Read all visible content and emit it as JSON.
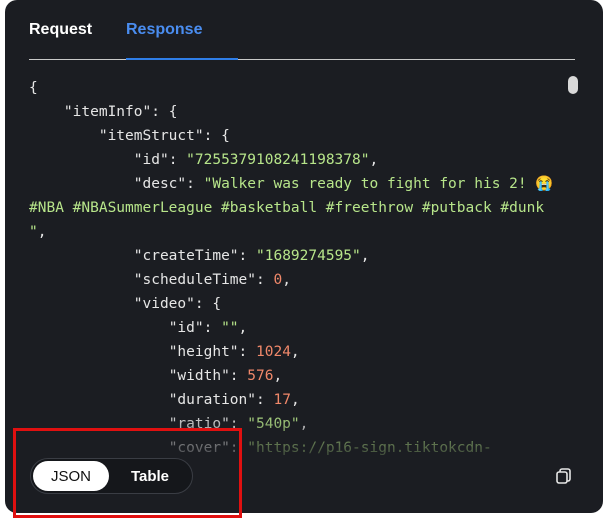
{
  "tabs": [
    {
      "label": "Request",
      "active": false
    },
    {
      "label": "Response",
      "active": true
    }
  ],
  "code_lines": [
    [
      {
        "t": "p",
        "v": "{"
      }
    ],
    [
      {
        "t": "p",
        "v": "    "
      },
      {
        "t": "k",
        "v": "\"itemInfo\""
      },
      {
        "t": "p",
        "v": ": {"
      }
    ],
    [
      {
        "t": "p",
        "v": "        "
      },
      {
        "t": "k",
        "v": "\"itemStruct\""
      },
      {
        "t": "p",
        "v": ": {"
      }
    ],
    [
      {
        "t": "p",
        "v": "            "
      },
      {
        "t": "k",
        "v": "\"id\""
      },
      {
        "t": "p",
        "v": ": "
      },
      {
        "t": "s",
        "v": "\"7255379108241198378\""
      },
      {
        "t": "p",
        "v": ","
      }
    ],
    [
      {
        "t": "p",
        "v": "            "
      },
      {
        "t": "k",
        "v": "\"desc\""
      },
      {
        "t": "p",
        "v": ": "
      },
      {
        "t": "s",
        "v": "\"Walker was ready to fight for his 2! "
      },
      {
        "t": "em",
        "v": "😭"
      }
    ],
    [
      {
        "t": "s",
        "v": "#NBA #NBASummerLeague #basketball #freethrow #putback #dunk"
      }
    ],
    [
      {
        "t": "s",
        "v": "\""
      },
      {
        "t": "p",
        "v": ","
      }
    ],
    [
      {
        "t": "p",
        "v": "            "
      },
      {
        "t": "k",
        "v": "\"createTime\""
      },
      {
        "t": "p",
        "v": ": "
      },
      {
        "t": "s",
        "v": "\"1689274595\""
      },
      {
        "t": "p",
        "v": ","
      }
    ],
    [
      {
        "t": "p",
        "v": "            "
      },
      {
        "t": "k",
        "v": "\"scheduleTime\""
      },
      {
        "t": "p",
        "v": ": "
      },
      {
        "t": "n",
        "v": "0"
      },
      {
        "t": "p",
        "v": ","
      }
    ],
    [
      {
        "t": "p",
        "v": "            "
      },
      {
        "t": "k",
        "v": "\"video\""
      },
      {
        "t": "p",
        "v": ": {"
      }
    ],
    [
      {
        "t": "p",
        "v": "                "
      },
      {
        "t": "k",
        "v": "\"id\""
      },
      {
        "t": "p",
        "v": ": "
      },
      {
        "t": "s",
        "v": "\"\""
      },
      {
        "t": "p",
        "v": ","
      }
    ],
    [
      {
        "t": "p",
        "v": "                "
      },
      {
        "t": "k",
        "v": "\"height\""
      },
      {
        "t": "p",
        "v": ": "
      },
      {
        "t": "n",
        "v": "1024"
      },
      {
        "t": "p",
        "v": ","
      }
    ],
    [
      {
        "t": "p",
        "v": "                "
      },
      {
        "t": "k",
        "v": "\"width\""
      },
      {
        "t": "p",
        "v": ": "
      },
      {
        "t": "n",
        "v": "576"
      },
      {
        "t": "p",
        "v": ","
      }
    ],
    [
      {
        "t": "p",
        "v": "                "
      },
      {
        "t": "k",
        "v": "\"duration\""
      },
      {
        "t": "p",
        "v": ": "
      },
      {
        "t": "n",
        "v": "17"
      },
      {
        "t": "p",
        "v": ","
      }
    ],
    [
      {
        "t": "p",
        "v": "                "
      },
      {
        "t": "k",
        "v": "\"ratio\""
      },
      {
        "t": "p",
        "v": ": "
      },
      {
        "t": "s",
        "v": "\"540p\""
      },
      {
        "t": "p",
        "v": ","
      }
    ],
    [
      {
        "t": "p",
        "v": "                "
      },
      {
        "t": "k",
        "v": "\"cover\""
      },
      {
        "t": "p",
        "v": ": "
      },
      {
        "t": "s",
        "v": "\"https://p16-sign.tiktokcdn-"
      }
    ]
  ],
  "view_toggle": {
    "json_label": "JSON",
    "table_label": "Table",
    "selected": "JSON"
  },
  "icons": {
    "copy": "copy-icon"
  },
  "colors": {
    "panel_bg": "#1b1d22",
    "active_tab": "#4a8df0",
    "string": "#b7e58a",
    "number": "#f0886a",
    "highlight": "#e01010"
  }
}
